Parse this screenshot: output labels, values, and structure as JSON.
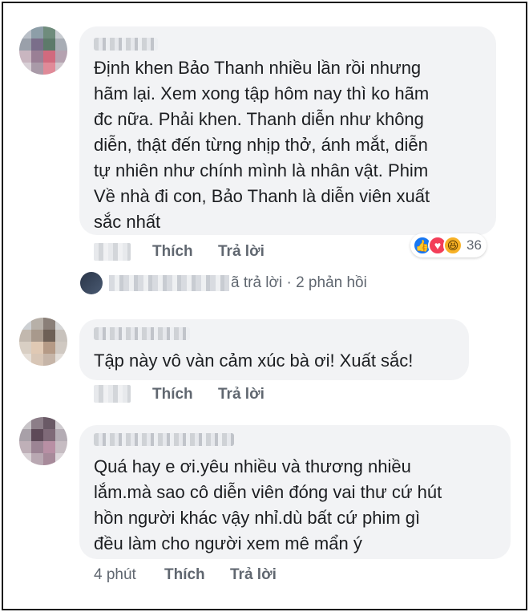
{
  "comments": [
    {
      "author_blurred": true,
      "text": "Định khen Bảo Thanh nhiều lần rồi nhưng\nhãm lại. Xem xong tập hôm nay thì ko hãm\nđc nữa. Phải khen. Thanh diễn như không\ndiễn, thật đến từng nhịp thở, ánh mắt, diễn\ntự nhiên như chính mình là nhân vật. Phim\nVề nhà đi con, Bảo Thanh là diễn viên xuất\nsắc nhất",
      "like_label": "Thích",
      "reply_label": "Trả lời",
      "reactions": {
        "icons": [
          "like-icon",
          "love-icon",
          "haha-icon"
        ],
        "count": "36"
      },
      "replies_summary": "ã trả lời · 2 phản hồi"
    },
    {
      "author_blurred": true,
      "text": "Tập này vô vàn cảm xúc bà ơi! Xuất sắc!",
      "like_label": "Thích",
      "reply_label": "Trả lời"
    },
    {
      "author_blurred": true,
      "text": "Quá hay e ơi.yêu nhiều và thương nhiều\nlắm.mà sao cô diễn viên đóng vai thư cứ hút\nhồn người khác vậy nhỉ.dù bất cứ phim gì\nđều làm cho người xem mê mẩn ý",
      "time": "4 phút",
      "like_label": "Thích",
      "reply_label": "Trả lời"
    }
  ],
  "colors": {
    "bubble": "#f2f3f5",
    "meta": "#606770",
    "like": "#1877f2",
    "love": "#f33e58",
    "haha": "#f7b125"
  }
}
